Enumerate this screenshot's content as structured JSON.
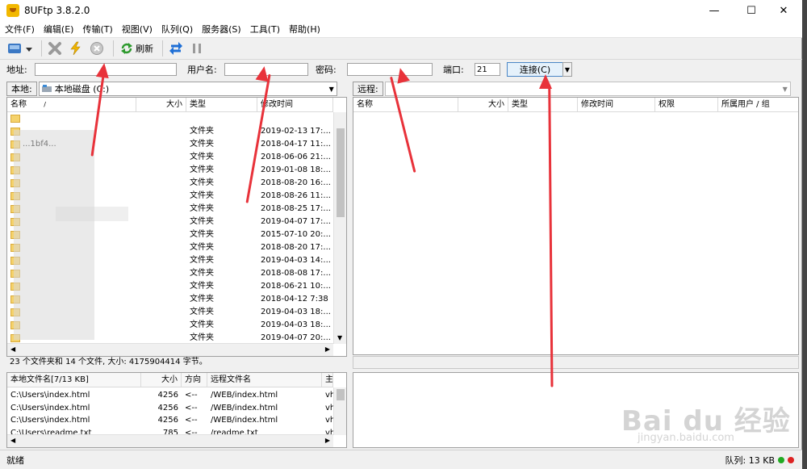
{
  "app": {
    "title": "8UFtp 3.8.2.0",
    "minimize": "—",
    "maximize": "☐",
    "close": "✕"
  },
  "menu": [
    "文件(F)",
    "编辑(E)",
    "传输(T)",
    "视图(V)",
    "队列(Q)",
    "服务器(S)",
    "工具(T)",
    "帮助(H)"
  ],
  "toolbar": {
    "refresh_label": "刷新"
  },
  "connect": {
    "address_label": "地址:",
    "address_value": "",
    "user_label": "用户名:",
    "user_value": "",
    "password_label": "密码:",
    "password_value": "",
    "port_label": "端口:",
    "port_value": "21",
    "connect_button": "连接(C)"
  },
  "local": {
    "tab": "本地:",
    "path": "本地磁盘 (C:)",
    "columns": [
      "名称",
      "大小",
      "类型",
      "修改时间"
    ],
    "rows": [
      {
        "name": "",
        "type": "",
        "date": ""
      },
      {
        "name": "",
        "type": "文件夹",
        "date": "2019-02-13 17:..."
      },
      {
        "name": "...1bf4...",
        "type": "文件夹",
        "date": "2018-04-17 11:..."
      },
      {
        "name": "",
        "type": "文件夹",
        "date": "2018-06-06 21:..."
      },
      {
        "name": "",
        "type": "文件夹",
        "date": "2019-01-08 18:..."
      },
      {
        "name": "",
        "type": "文件夹",
        "date": "2018-08-20 16:..."
      },
      {
        "name": "",
        "type": "文件夹",
        "date": "2018-08-26 11:..."
      },
      {
        "name": "",
        "type": "文件夹",
        "date": "2018-08-25 17:..."
      },
      {
        "name": "",
        "type": "文件夹",
        "date": "2019-04-07 17:..."
      },
      {
        "name": "",
        "type": "文件夹",
        "date": "2015-07-10 20:..."
      },
      {
        "name": "",
        "type": "文件夹",
        "date": "2018-08-20 17:..."
      },
      {
        "name": "",
        "type": "文件夹",
        "date": "2019-04-03 14:..."
      },
      {
        "name": "",
        "type": "文件夹",
        "date": "2018-08-08 17:..."
      },
      {
        "name": "",
        "type": "文件夹",
        "date": "2018-06-21 10:..."
      },
      {
        "name": "",
        "type": "文件夹",
        "date": "2018-04-12 7:38"
      },
      {
        "name": "",
        "type": "文件夹",
        "date": "2019-04-03 18:..."
      },
      {
        "name": "",
        "type": "文件夹",
        "date": "2019-04-03 18:..."
      },
      {
        "name": "",
        "type": "文件夹",
        "date": "2019-04-07 20:..."
      }
    ],
    "status": "23 个文件夹和 14 个文件, 大小: 4175904414 字节。"
  },
  "remote": {
    "tab": "远程:",
    "path": "",
    "columns": [
      "名称",
      "大小",
      "类型",
      "修改时间",
      "权限",
      "所属用户 / 组"
    ],
    "status": ""
  },
  "queue": {
    "columns": [
      "本地文件名[7/13 KB]",
      "大小",
      "方向",
      "远程文件名",
      "主"
    ],
    "rows": [
      {
        "local": "C:\\Users\\index.html",
        "size": "4256",
        "dir": "<--",
        "remote": "/WEB/index.html",
        "host": "vhc"
      },
      {
        "local": "C:\\Users\\index.html",
        "size": "4256",
        "dir": "<--",
        "remote": "/WEB/index.html",
        "host": "vhc"
      },
      {
        "local": "C:\\Users\\index.html",
        "size": "4256",
        "dir": "<--",
        "remote": "/WEB/index.html",
        "host": "vhc"
      },
      {
        "local": "C:\\Users\\readme.txt",
        "size": "785",
        "dir": "<--",
        "remote": "/readme.txt",
        "host": "vhc"
      }
    ]
  },
  "statusbar": {
    "left": "就绪",
    "queue": "队列: 13 KB"
  },
  "watermark": {
    "brand": "Bai du 经验",
    "url": "jingyan.baidu.com"
  },
  "colors": {
    "accent": "#0078d7",
    "arrow": "#e8323a",
    "folder": "#f5d26b"
  }
}
